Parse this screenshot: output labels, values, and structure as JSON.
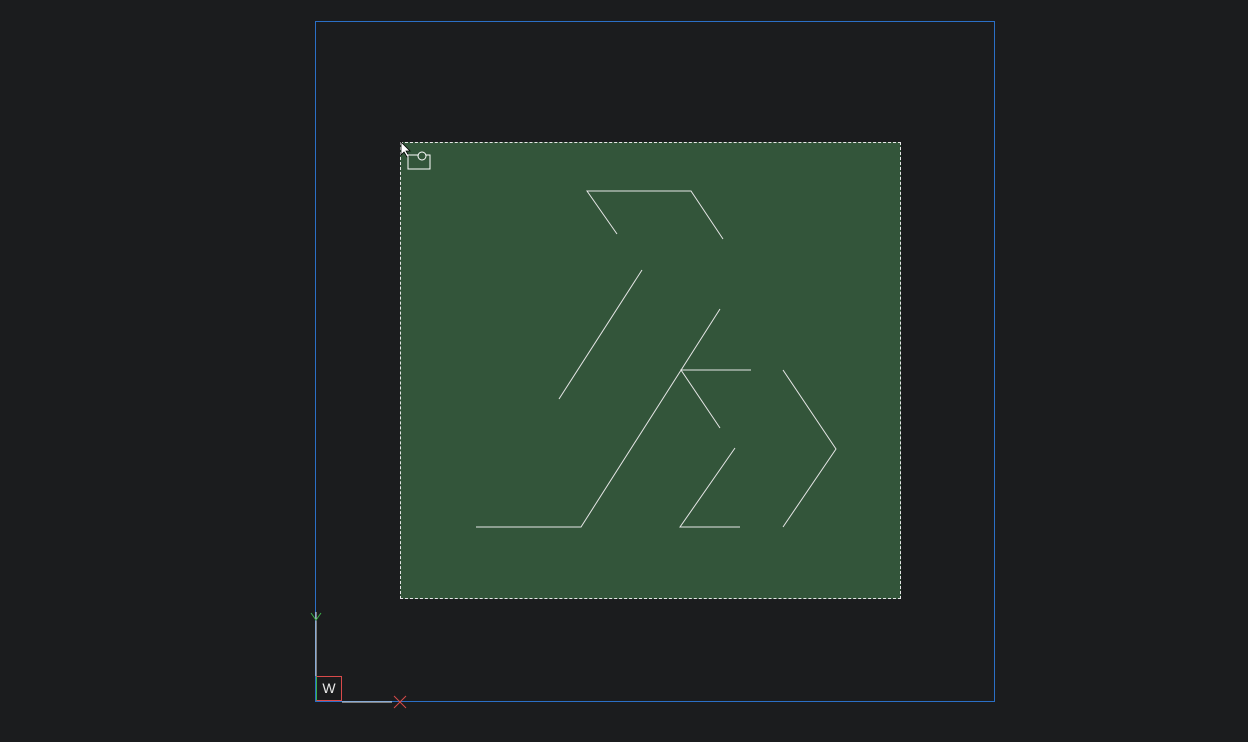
{
  "viewport": {
    "background_color": "#1b1c1e",
    "frame_color": "#2b6fc6",
    "selection_fill": "#33553a",
    "selection_border": "#e6e6e6"
  },
  "ucs_icon": {
    "label": "W",
    "x_axis_color": "#d94a4a",
    "y_axis_color": "#3cb04a"
  },
  "drawing": {
    "line_color": "#e6e6e6",
    "entity": "line-geometry"
  },
  "cursor": {
    "icon": "window-select-cursor"
  }
}
